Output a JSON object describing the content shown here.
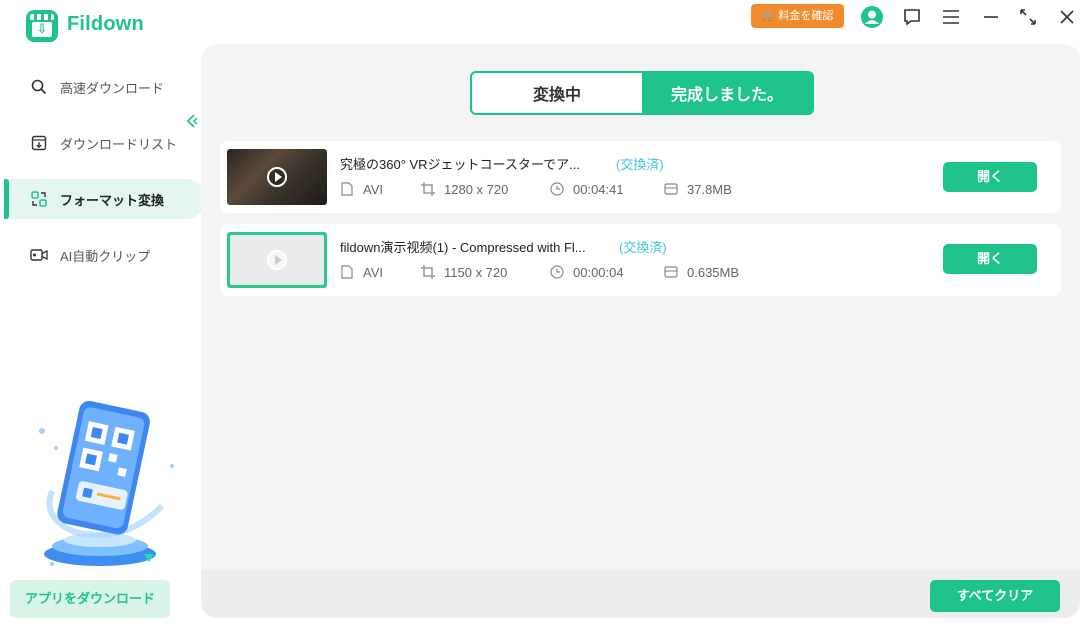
{
  "app": {
    "name": "Fildown"
  },
  "titlebar": {
    "price_label": "料金を確認",
    "icons": [
      "cart-icon",
      "avatar-icon",
      "chat-icon",
      "menu-icon",
      "minimize-icon",
      "maximize-icon",
      "close-icon"
    ]
  },
  "sidebar": {
    "items": [
      {
        "label": "高速ダウンロード",
        "icon": "search-icon"
      },
      {
        "label": "ダウンロードリスト",
        "icon": "download-list-icon"
      },
      {
        "label": "フォーマット変換",
        "icon": "format-convert-icon",
        "active": true
      },
      {
        "label": "AI自動クリップ",
        "icon": "ai-clip-icon"
      }
    ],
    "download_app_label": "アプリをダウンロード"
  },
  "tabs": [
    {
      "label": "変換中",
      "active": false
    },
    {
      "label": "完成しました。",
      "active": true
    }
  ],
  "files": [
    {
      "name": "究極の360° VRジェットコースターでア...",
      "status": "(交換済)",
      "format": "AVI",
      "resolution": "1280 x 720",
      "duration": "00:04:41",
      "size": "37.8MB",
      "open_label": "開く"
    },
    {
      "name": "fildown演示视频(1) - Compressed with Fl...",
      "status": "(交換済)",
      "format": "AVI",
      "resolution": "1150 x 720",
      "duration": "00:00:04",
      "size": "0.635MB",
      "open_label": "開く"
    }
  ],
  "footer": {
    "clear_all_label": "すべてクリア"
  },
  "colors": {
    "accent": "#1ec38a",
    "price": "#f28a2e",
    "status": "#3cc6d8",
    "panel": "#f3f4f5"
  }
}
